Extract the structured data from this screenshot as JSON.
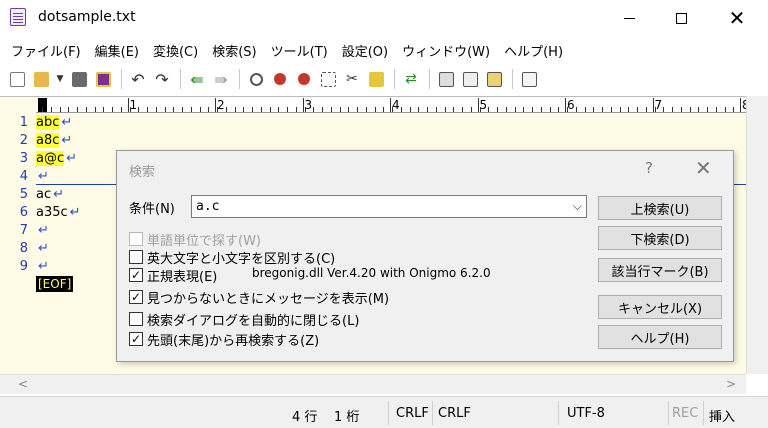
{
  "window": {
    "title": "dotsample.txt",
    "min": "—",
    "max": "☐",
    "close": "✕"
  },
  "menu": [
    "ファイル(F)",
    "編集(E)",
    "変換(C)",
    "検索(S)",
    "ツール(T)",
    "設定(O)",
    "ウィンドウ(W)",
    "ヘルプ(H)"
  ],
  "editor": {
    "ruler_numbers": [
      "1",
      "2",
      "3",
      "4",
      "5",
      "6",
      "7",
      "8"
    ],
    "line_numbers": [
      "1",
      "2",
      "3",
      "4",
      "5",
      "6",
      "7",
      "8",
      "9"
    ],
    "lines": [
      "abc",
      "a8c",
      "a@c",
      "",
      "ac",
      "a35c",
      "",
      "",
      ""
    ],
    "return_mark": "↵",
    "eof": "[EOF]"
  },
  "status": {
    "row": "4 行",
    "col": "1 桁",
    "eol1": "CRLF",
    "eol2": "CRLF",
    "encoding": "UTF-8",
    "rec": "REC",
    "mode": "挿入"
  },
  "dialog": {
    "title": "検索",
    "help": "?",
    "close": "✕",
    "condition_label": "条件(N)",
    "condition_value": "a.c",
    "options": {
      "word": "単語単位で探す(W)",
      "case": "英大文字と小文字を区別する(C)",
      "regex": "正規表現(E)",
      "notfound": "見つからないときにメッセージを表示(M)",
      "autoclose": "検索ダイアログを自動的に閉じる(L)",
      "wrap": "先頭(末尾)から再検索する(Z)"
    },
    "regex_info": "bregonig.dll Ver.4.20 with Onigmo 6.2.0",
    "buttons": {
      "up": "上検索(U)",
      "down": "下検索(D)",
      "mark": "該当行マーク(B)",
      "cancel": "キャンセル(X)",
      "help": "ヘルプ(H)"
    },
    "check": "✓"
  }
}
